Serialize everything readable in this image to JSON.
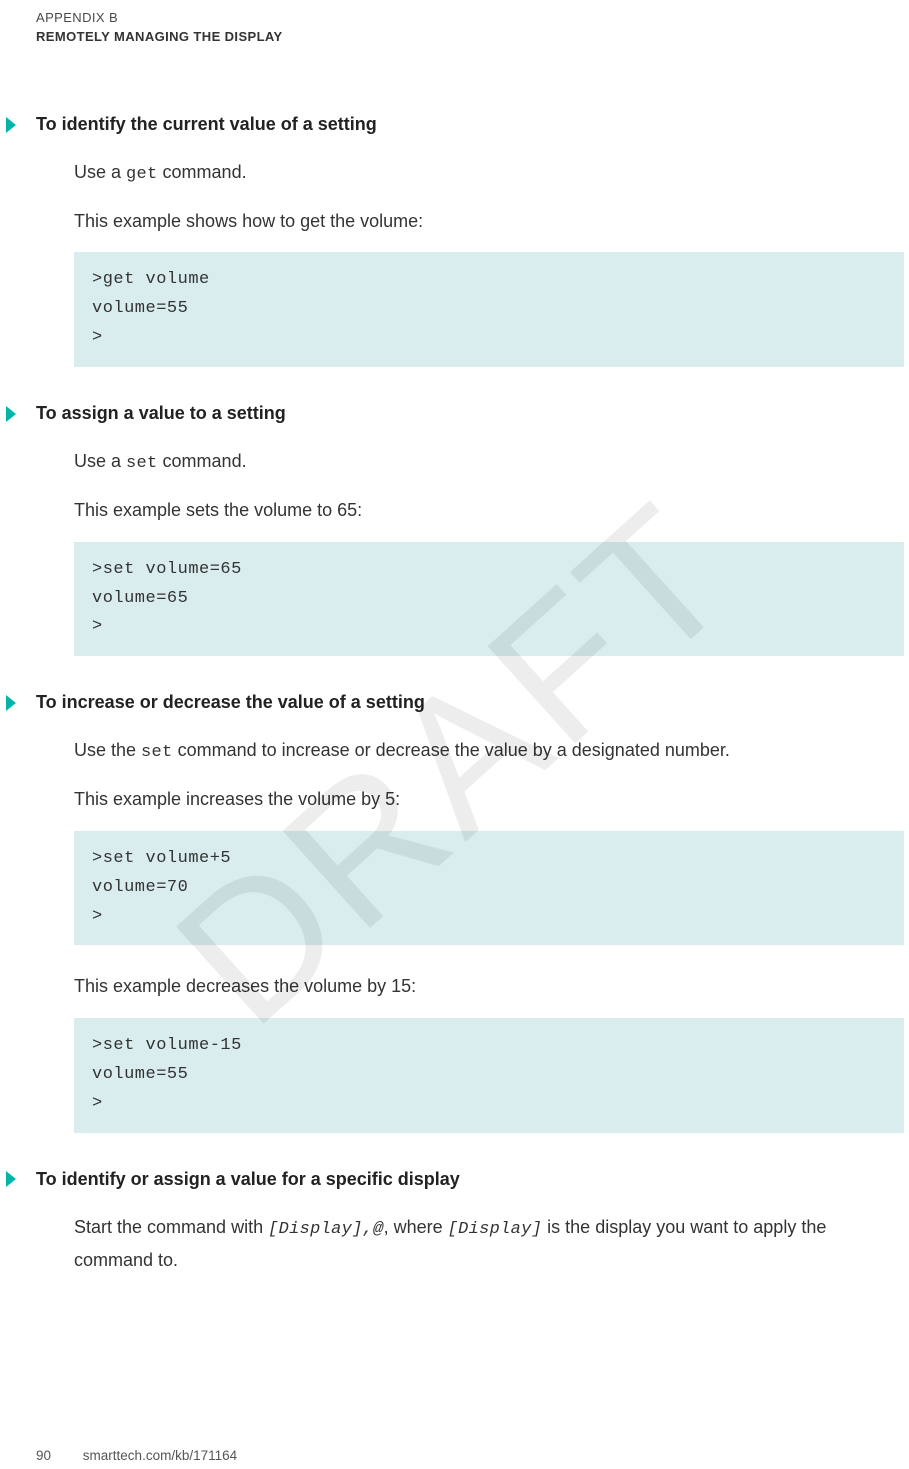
{
  "header": {
    "appendix": "APPENDIX B",
    "title": "REMOTELY MANAGING THE DISPLAY"
  },
  "watermark": "DRAFT",
  "sections": [
    {
      "title": "To identify the current value of a setting",
      "paras": [
        {
          "pre": "Use a ",
          "code": "get",
          "post": " command."
        },
        {
          "pre": "This example shows how to get the volume:",
          "code": "",
          "post": ""
        }
      ],
      "codeblocks": [
        ">get volume\nvolume=55\n>"
      ]
    },
    {
      "title": "To assign a value to a setting",
      "paras": [
        {
          "pre": "Use a ",
          "code": "set",
          "post": " command."
        },
        {
          "pre": "This example sets the volume to 65:",
          "code": "",
          "post": ""
        }
      ],
      "codeblocks": [
        ">set volume=65\nvolume=65\n>"
      ]
    },
    {
      "title": "To increase or decrease the value of a setting",
      "paras": [
        {
          "pre": "Use the ",
          "code": "set",
          "post": " command to increase or decrease the value by a designated number."
        },
        {
          "pre": "This example increases the volume by 5:",
          "code": "",
          "post": ""
        }
      ],
      "codeblocks": [
        ">set volume+5\nvolume=70\n>"
      ],
      "paras2": [
        {
          "pre": "This example decreases the volume by 15:",
          "code": "",
          "post": ""
        }
      ],
      "codeblocks2": [
        ">set volume-15\nvolume=55\n>"
      ]
    },
    {
      "title": "To identify or assign a value for a specific display",
      "paras": [
        {
          "pre": "Start the command with ",
          "codeit": "[Display],@",
          "mid": ", where ",
          "codeit2": "[Display]",
          "post": " is the display you want to apply the command to."
        }
      ]
    }
  ],
  "footer": {
    "page": "90",
    "url": "smarttech.com/kb/171164"
  }
}
